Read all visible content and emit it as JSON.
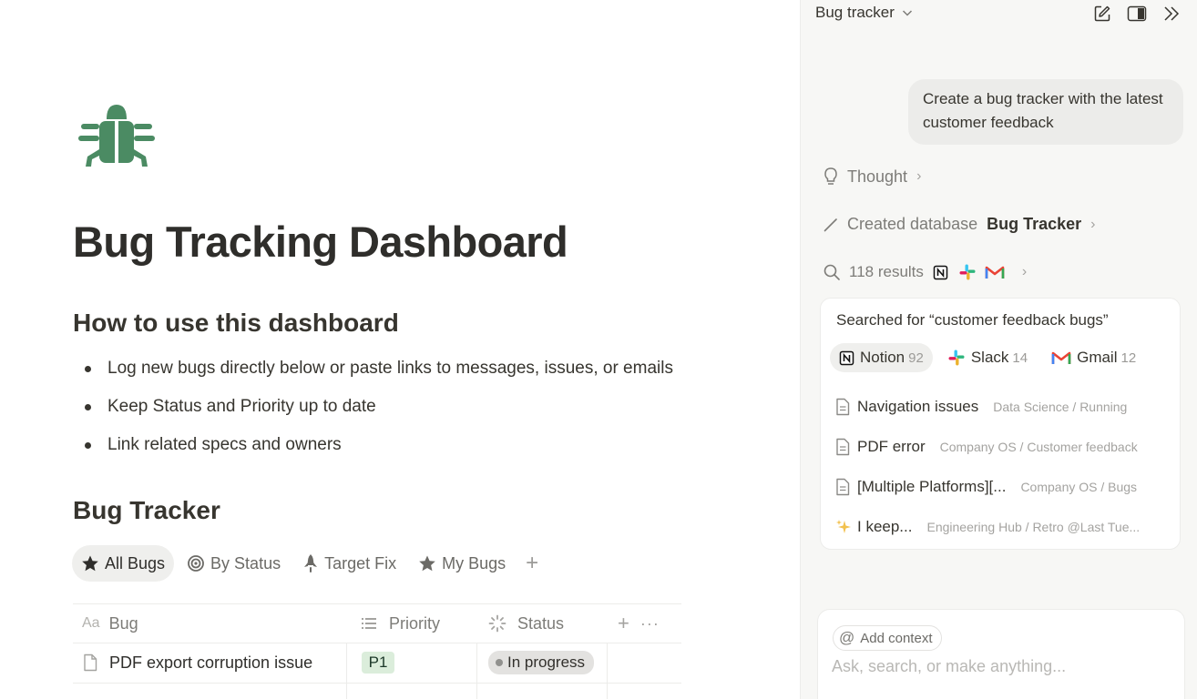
{
  "page": {
    "title": "Bug Tracking Dashboard",
    "icon": "bug-icon",
    "icon_color": "#4b8b63",
    "how_to_heading": "How to use this dashboard",
    "bullets": [
      "Log new bugs directly below or paste links to messages, issues, or emails",
      "Keep Status and Priority up to date",
      "Link related specs and owners"
    ],
    "database_heading": "Bug Tracker"
  },
  "views": [
    {
      "label": "All Bugs",
      "icon": "star-icon",
      "active": true
    },
    {
      "label": "By Status",
      "icon": "target-icon",
      "active": false
    },
    {
      "label": "Target Fix",
      "icon": "rocket-icon",
      "active": false
    },
    {
      "label": "My Bugs",
      "icon": "star-icon",
      "active": false
    }
  ],
  "table": {
    "columns": [
      {
        "label": "Bug",
        "icon": "text-property-icon",
        "icon_text": "Aa"
      },
      {
        "label": "Priority",
        "icon": "list-icon"
      },
      {
        "label": "Status",
        "icon": "status-icon"
      }
    ],
    "rows": [
      {
        "bug": "PDF export corruption issue",
        "priority": "P1",
        "priority_color": "#dbeddb",
        "priority_text_color": "#1c3829",
        "status": "In progress"
      },
      {
        "bug": "",
        "priority": "",
        "priority_color": "#fdecc8",
        "status": ""
      }
    ]
  },
  "sidebar": {
    "title": "Bug tracker",
    "user_message": "Create a bug tracker with the latest customer feedback",
    "steps": {
      "thought": "Thought",
      "created_label": "Created database",
      "created_name": "Bug Tracker",
      "results": "118 results"
    },
    "search": {
      "query_text": "Searched for “customer feedback bugs”",
      "sources": [
        {
          "name": "Notion",
          "count": "92",
          "icon": "notion-icon",
          "active": true
        },
        {
          "name": "Slack",
          "count": "14",
          "icon": "slack-icon",
          "active": false
        },
        {
          "name": "Gmail",
          "count": "12",
          "icon": "gmail-icon",
          "active": false
        }
      ],
      "results": [
        {
          "title": "Navigation issues",
          "path": "Data Science / Running",
          "icon": "page-icon"
        },
        {
          "title": "PDF error",
          "path": "Company OS / Customer feedback",
          "icon": "page-icon"
        },
        {
          "title": "[Multiple Platforms][...",
          "path": "Company OS / Bugs",
          "icon": "page-icon"
        },
        {
          "title": "I keep...",
          "path": "Engineering Hub / Retro @Last Tue...",
          "icon": "sparkle-icon"
        }
      ]
    },
    "input": {
      "add_context": "Add context",
      "placeholder": "Ask, search, or make anything..."
    }
  }
}
